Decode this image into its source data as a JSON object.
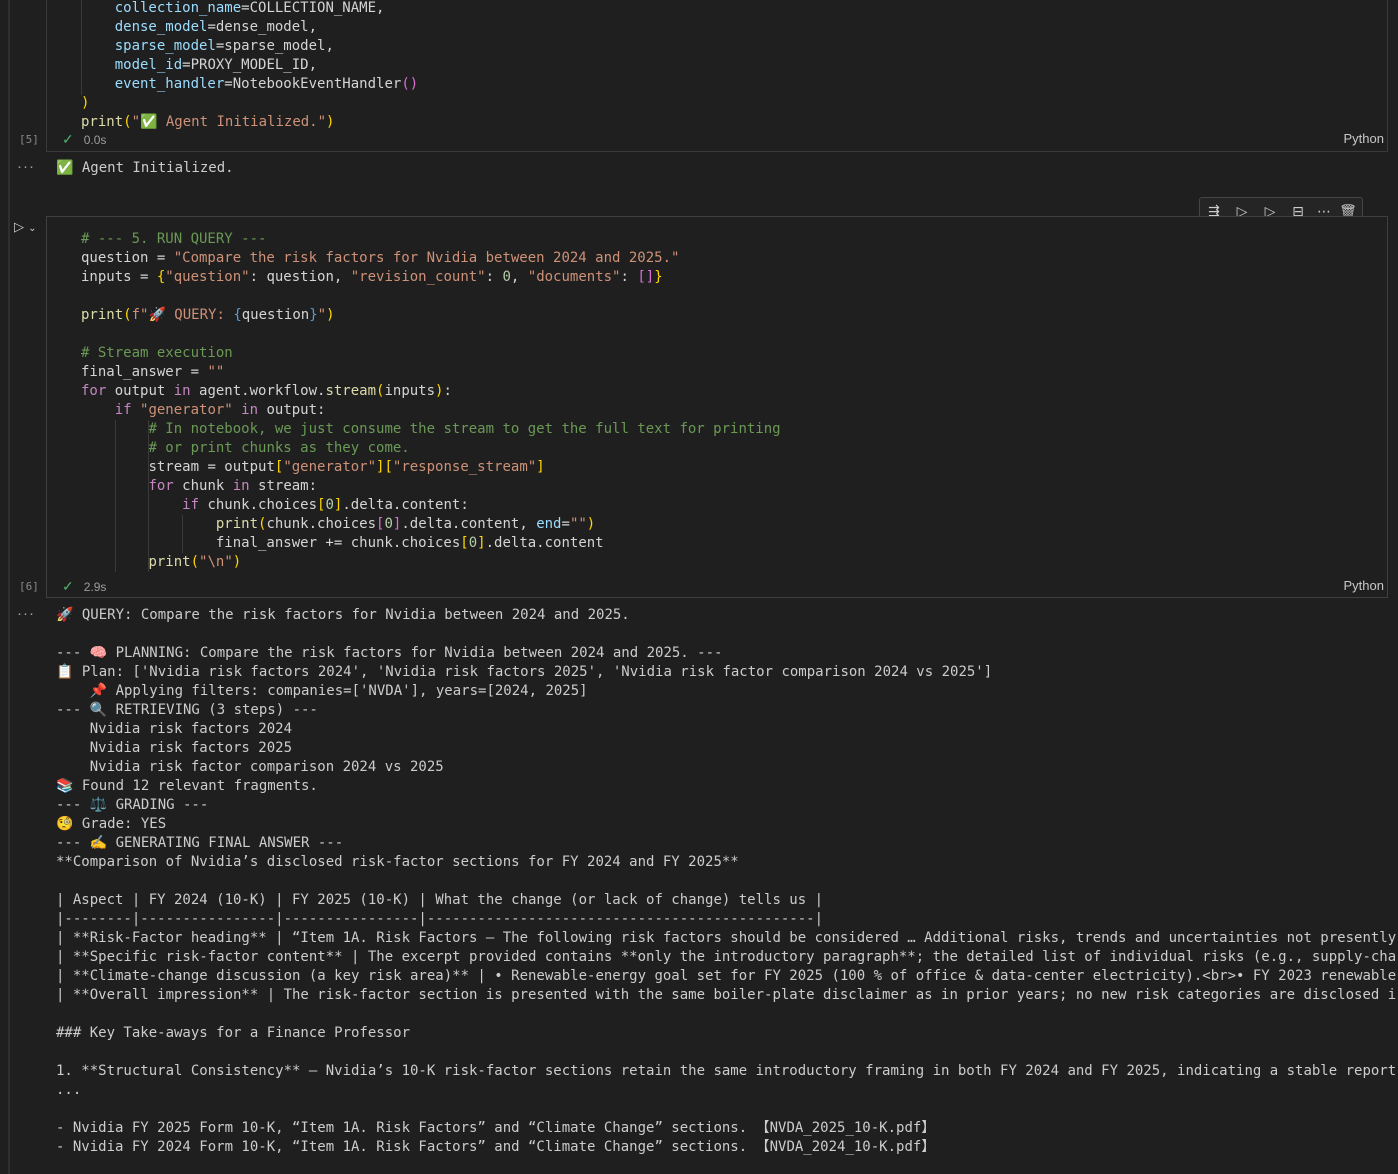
{
  "cell5": {
    "code_lines": [
      [
        [
          "    ",
          ""
        ],
        [
          "collection_name",
          "v"
        ],
        [
          "=COLLECTION_NAME,",
          "w"
        ]
      ],
      [
        [
          "    ",
          ""
        ],
        [
          "dense_model",
          "v"
        ],
        [
          "=dense_model,",
          "w"
        ]
      ],
      [
        [
          "    ",
          ""
        ],
        [
          "sparse_model",
          "v"
        ],
        [
          "=sparse_model,",
          "w"
        ]
      ],
      [
        [
          "    ",
          ""
        ],
        [
          "model_id",
          "v"
        ],
        [
          "=PROXY_MODEL_ID,",
          "w"
        ]
      ],
      [
        [
          "    ",
          ""
        ],
        [
          "event_handler",
          "v"
        ],
        [
          "=NotebookEventHandler",
          "w"
        ],
        [
          "()",
          "p2"
        ]
      ],
      [
        [
          ")",
          "p"
        ]
      ],
      [
        [
          "print",
          "fn"
        ],
        [
          "(",
          "p"
        ],
        [
          "\"✅ Agent Initialized.\"",
          "s"
        ],
        [
          ")",
          "p"
        ]
      ]
    ],
    "exec_count": "[5]",
    "duration": "0.0s",
    "language": "Python",
    "output": "✅ Agent Initialized."
  },
  "cell6": {
    "code_lines": [
      [
        [
          "# --- 5. RUN QUERY ---",
          "c"
        ]
      ],
      [
        [
          "question ",
          "w"
        ],
        [
          "= ",
          "w"
        ],
        [
          "\"Compare the risk factors for Nvidia between 2024 and 2025.\"",
          "s"
        ]
      ],
      [
        [
          "inputs = ",
          "w"
        ],
        [
          "{",
          "p"
        ],
        [
          "\"question\"",
          "s"
        ],
        [
          ": question, ",
          "w"
        ],
        [
          "\"revision_count\"",
          "s"
        ],
        [
          ": ",
          "w"
        ],
        [
          "0",
          "n"
        ],
        [
          ", ",
          "w"
        ],
        [
          "\"documents\"",
          "s"
        ],
        [
          ": ",
          "w"
        ],
        [
          "[]",
          "p2"
        ],
        [
          "}",
          "p"
        ]
      ],
      [
        [
          "",
          ""
        ]
      ],
      [
        [
          "print",
          "fn"
        ],
        [
          "(",
          "p"
        ],
        [
          "f\"🚀 QUERY: ",
          "s"
        ],
        [
          "{",
          "bl"
        ],
        [
          "question",
          "w"
        ],
        [
          "}",
          "bl"
        ],
        [
          "\"",
          "s"
        ],
        [
          ")",
          "p"
        ]
      ],
      [
        [
          "",
          ""
        ]
      ],
      [
        [
          "# Stream execution",
          "c"
        ]
      ],
      [
        [
          "final_answer = ",
          "w"
        ],
        [
          "\"\"",
          "s"
        ]
      ],
      [
        [
          "for",
          "k"
        ],
        [
          " output ",
          "w"
        ],
        [
          "in",
          "k"
        ],
        [
          " agent.workflow.",
          "w"
        ],
        [
          "stream",
          "fn"
        ],
        [
          "(",
          "p"
        ],
        [
          "inputs",
          "w"
        ],
        [
          ")",
          "p"
        ],
        [
          ":",
          "w"
        ]
      ],
      [
        [
          "    ",
          ""
        ],
        [
          "if",
          "k"
        ],
        [
          " ",
          "w"
        ],
        [
          "\"generator\"",
          "s"
        ],
        [
          " ",
          "w"
        ],
        [
          "in",
          "k"
        ],
        [
          " output:",
          "w"
        ]
      ],
      [
        [
          "        ",
          ""
        ],
        [
          "# In notebook, we just consume the stream to get the full text for printing",
          "c"
        ]
      ],
      [
        [
          "        ",
          ""
        ],
        [
          "# or print chunks as they come.",
          "c"
        ]
      ],
      [
        [
          "        ",
          ""
        ],
        [
          "stream = output",
          "w"
        ],
        [
          "[",
          "p"
        ],
        [
          "\"generator\"",
          "s"
        ],
        [
          "][",
          "p"
        ],
        [
          "\"response_stream\"",
          "s"
        ],
        [
          "]",
          "p"
        ]
      ],
      [
        [
          "        ",
          ""
        ],
        [
          "for",
          "k"
        ],
        [
          " chunk ",
          "w"
        ],
        [
          "in",
          "k"
        ],
        [
          " stream:",
          "w"
        ]
      ],
      [
        [
          "            ",
          ""
        ],
        [
          "if",
          "k"
        ],
        [
          " chunk.choices",
          "w"
        ],
        [
          "[",
          "p"
        ],
        [
          "0",
          "n"
        ],
        [
          "]",
          "p"
        ],
        [
          ".delta.content:",
          "w"
        ]
      ],
      [
        [
          "                ",
          ""
        ],
        [
          "print",
          "fn"
        ],
        [
          "(",
          "p"
        ],
        [
          "chunk.choices",
          "w"
        ],
        [
          "[",
          "p2"
        ],
        [
          "0",
          "n"
        ],
        [
          "]",
          "p2"
        ],
        [
          ".delta.content, ",
          "w"
        ],
        [
          "end",
          "v"
        ],
        [
          "=",
          "w"
        ],
        [
          "\"\"",
          "s"
        ],
        [
          ")",
          "p"
        ]
      ],
      [
        [
          "                ",
          ""
        ],
        [
          "final_answer += chunk.choices",
          "w"
        ],
        [
          "[",
          "p"
        ],
        [
          "0",
          "n"
        ],
        [
          "]",
          "p"
        ],
        [
          ".delta.content",
          "w"
        ]
      ],
      [
        [
          "        ",
          ""
        ],
        [
          "print",
          "fn"
        ],
        [
          "(",
          "p"
        ],
        [
          "\"\\n\"",
          "s"
        ],
        [
          ")",
          "p"
        ]
      ]
    ],
    "exec_count": "[6]",
    "duration": "2.9s",
    "language": "Python",
    "output_lines": [
      "🚀 QUERY: Compare the risk factors for Nvidia between 2024 and 2025.",
      "",
      "--- 🧠 PLANNING: Compare the risk factors for Nvidia between 2024 and 2025. ---",
      "📋 Plan: ['Nvidia risk factors 2024', 'Nvidia risk factors 2025', 'Nvidia risk factor comparison 2024 vs 2025']",
      "    📌 Applying filters: companies=['NVDA'], years=[2024, 2025]",
      "--- 🔍 RETRIEVING (3 steps) ---",
      "    Nvidia risk factors 2024",
      "    Nvidia risk factors 2025",
      "    Nvidia risk factor comparison 2024 vs 2025",
      "📚 Found 12 relevant fragments.",
      "--- ⚖️ GRADING ---",
      "🧐 Grade: YES",
      "--- ✍️ GENERATING FINAL ANSWER ---",
      "**Comparison of Nvidia’s disclosed risk-factor sections for FY 2024 and FY 2025**",
      "",
      "| Aspect | FY 2024 (10-K) | FY 2025 (10-K) | What the change (or lack of change) tells us |",
      "|--------|----------------|----------------|----------------------------------------------|",
      "| **Risk-Factor heading** | “Item 1A. Risk Factors – The following risk factors should be considered … Additional risks, trends and uncertainties not presently",
      "| **Specific risk-factor content** | The excerpt provided contains **only the introductory paragraph**; the detailed list of individual risks (e.g., supply-cha",
      "| **Climate-change discussion (a key risk area)** | • Renewable-energy goal set for FY 2025 (100 % of office & data-center electricity).<br>• FY 2023 renewable",
      "| **Overall impression** | The risk-factor section is presented with the same boiler-plate disclaimer as in prior years; no new risk categories are disclosed i",
      "",
      "### Key Take-aways for a Finance Professor",
      "",
      "1. **Structural Consistency** – Nvidia’s 10-K risk-factor sections retain the same introductory framing in both FY 2024 and FY 2025, indicating a stable report",
      "...",
      "",
      "- Nvidia FY 2025 Form 10-K, “Item 1A. Risk Factors” and “Climate Change” sections. 【NVDA_2025_10-K.pdf】",
      "- Nvidia FY 2024 Form 10-K, “Item 1A. Risk Factors” and “Climate Change” sections. 【NVDA_2024_10-K.pdf】"
    ]
  },
  "toolbar": {
    "icons": [
      "execute-above-icon",
      "run-below-icon",
      "run-cell-below-icon",
      "split-cell-icon",
      "more-icon",
      "delete-icon"
    ]
  },
  "ui": {
    "output_ellipsis": "···"
  }
}
